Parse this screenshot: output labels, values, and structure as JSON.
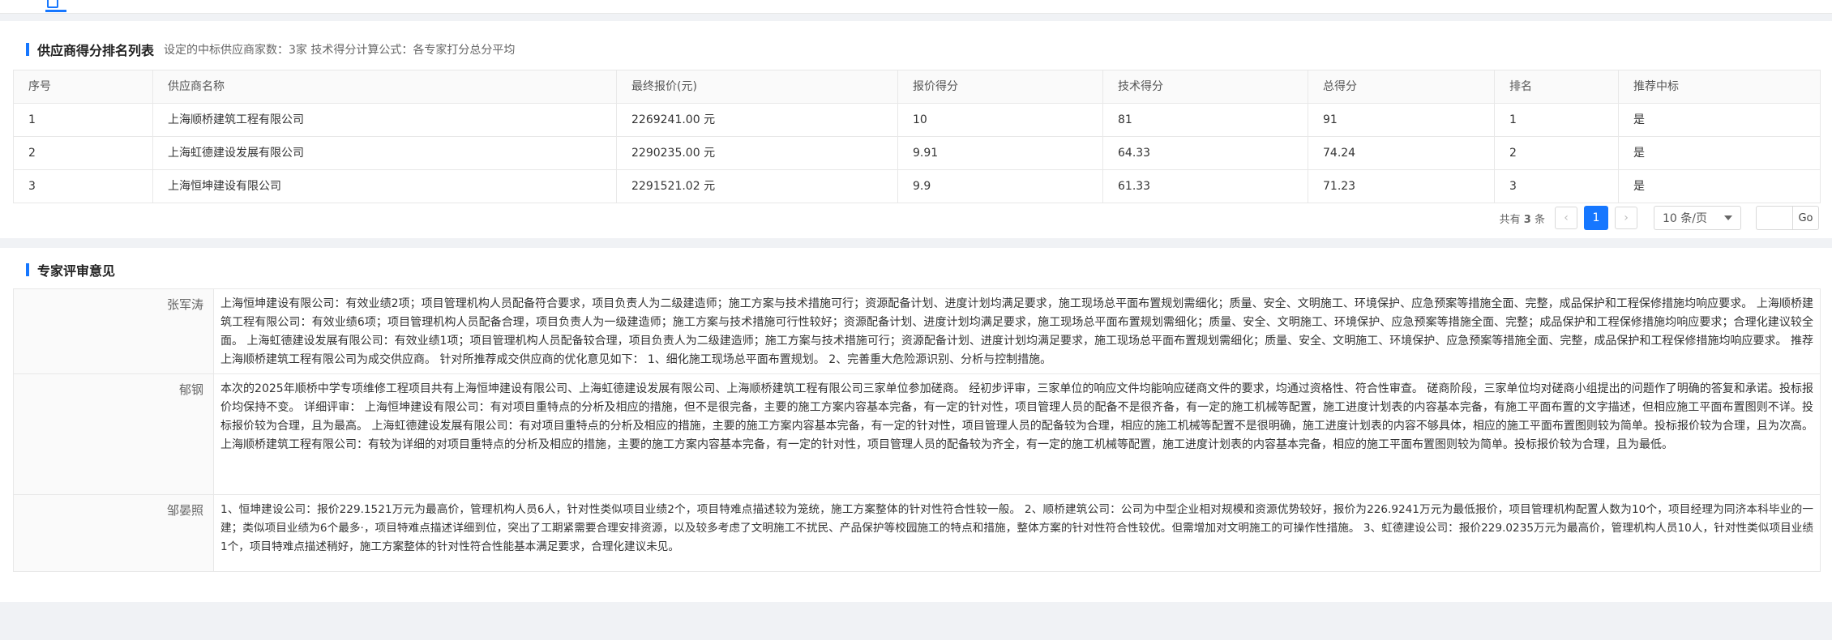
{
  "ranking": {
    "title": "供应商得分排名列表",
    "description": "设定的中标供应商家数：3家 技术得分计算公式：各专家打分总分平均",
    "columns": [
      "序号",
      "供应商名称",
      "最终报价(元)",
      "报价得分",
      "技术得分",
      "总得分",
      "排名",
      "推荐中标"
    ],
    "rows": [
      [
        "1",
        "上海顺桥建筑工程有限公司",
        "2269241.00 元",
        "10",
        "81",
        "91",
        "1",
        "是"
      ],
      [
        "2",
        "上海虹德建设发展有限公司",
        "2290235.00 元",
        "9.91",
        "64.33",
        "74.24",
        "2",
        "是"
      ],
      [
        "3",
        "上海恒坤建设有限公司",
        "2291521.02 元",
        "9.9",
        "61.33",
        "71.23",
        "3",
        "是"
      ]
    ],
    "pagination": {
      "total_prefix": "共有",
      "total_count": "3",
      "total_suffix": "条",
      "prev_icon": "chevron-left-icon",
      "next_icon": "chevron-right-icon",
      "current_page": "1",
      "page_size": "10 条/页",
      "go_label": "Go",
      "jump_value": ""
    }
  },
  "opinions": {
    "title": "专家评审意见",
    "items": [
      {
        "expert": "张军涛",
        "text": "上海恒坤建设有限公司：有效业绩2项；项目管理机构人员配备符合要求，项目负责人为二级建造师；施工方案与技术措施可行；资源配备计划、进度计划均满足要求，施工现场总平面布置规划需细化；质量、安全、文明施工、环境保护、应急预案等措施全面、完整，成品保护和工程保修措施均响应要求。 上海顺桥建筑工程有限公司：有效业绩6项；项目管理机构人员配备合理，项目负责人为一级建造师；施工方案与技术措施可行性较好；资源配备计划、进度计划均满足要求，施工现场总平面布置规划需细化；质量、安全、文明施工、环境保护、应急预案等措施全面、完整；成品保护和工程保修措施均响应要求；合理化建议较全面。 上海虹德建设发展有限公司：有效业绩1项；项目管理机构人员配备较合理，项目负责人为二级建造师；施工方案与技术措施可行；资源配备计划、进度计划均满足要求，施工现场总平面布置规划需细化；质量、安全、文明施工、环境保护、应急预案等措施全面、完整，成品保护和工程保修措施均响应要求。 推荐上海顺桥建筑工程有限公司为成交供应商。 针对所推荐成交供应商的优化意见如下： 1、细化施工现场总平面布置规划。 2、完善重大危险源识别、分析与控制措施。"
      },
      {
        "expert": "郁钢",
        "text": "本次的2025年顺桥中学专项维修工程项目共有上海恒坤建设有限公司、上海虹德建设发展有限公司、上海顺桥建筑工程有限公司三家单位参加磋商。 经初步评审，三家单位的响应文件均能响应磋商文件的要求，均通过资格性、符合性审查。 磋商阶段，三家单位均对磋商小组提出的问题作了明确的答复和承诺。投标报价均保持不变。 详细评审： 上海恒坤建设有限公司：有对项目重特点的分析及相应的措施，但不是很完备，主要的施工方案内容基本完备，有一定的针对性，项目管理人员的配备不是很齐备，有一定的施工机械等配置，施工进度计划表的内容基本完备，有施工平面布置的文字描述，但相应施工平面布置图则不详。投标报价较为合理，且为最高。 上海虹德建设发展有限公司：有对项目重特点的分析及相应的措施，主要的施工方案内容基本完备，有一定的针对性，项目管理人员的配备较为合理，相应的施工机械等配置不是很明确，施工进度计划表的内容不够具体，相应的施工平面布置图则较为简单。投标报价较为合理，且为次高。 上海顺桥建筑工程有限公司：有较为详细的对项目重特点的分析及相应的措施，主要的施工方案内容基本完备，有一定的针对性，项目管理人员的配备较为齐全，有一定的施工机械等配置，施工进度计划表的内容基本完备，相应的施工平面布置图则较为简单。投标报价较为合理，且为最低。"
      },
      {
        "expert": "邹晏照",
        "text": "1、恒坤建设公司：报价229.1521万元为最高价，管理机构人员6人，针对性类似项目业绩2个，项目特难点描述较为笼统，施工方案整体的针对性符合性较一般。 2、顺桥建筑公司：公司为中型企业相对规模和资源优势较好，报价为226.9241万元为最低报价，项目管理机构配置人数为10个，项目经理为同济本科毕业的一建；类似项目业绩为6个最多·，项目特难点描述详细到位，突出了工期紧需要合理安排资源，以及较多考虑了文明施工不扰民、产品保护等校园施工的特点和措施，整体方案的针对性符合性较优。但需增加对文明施工的可操作性措施。 3、虹德建设公司：报价229.0235万元为最高价，管理机构人员10人，针对性类似项目业绩1个，项目特难点描述稍好，施工方案整体的针对性符合性能基本满足要求，合理化建议未见。"
      }
    ]
  }
}
